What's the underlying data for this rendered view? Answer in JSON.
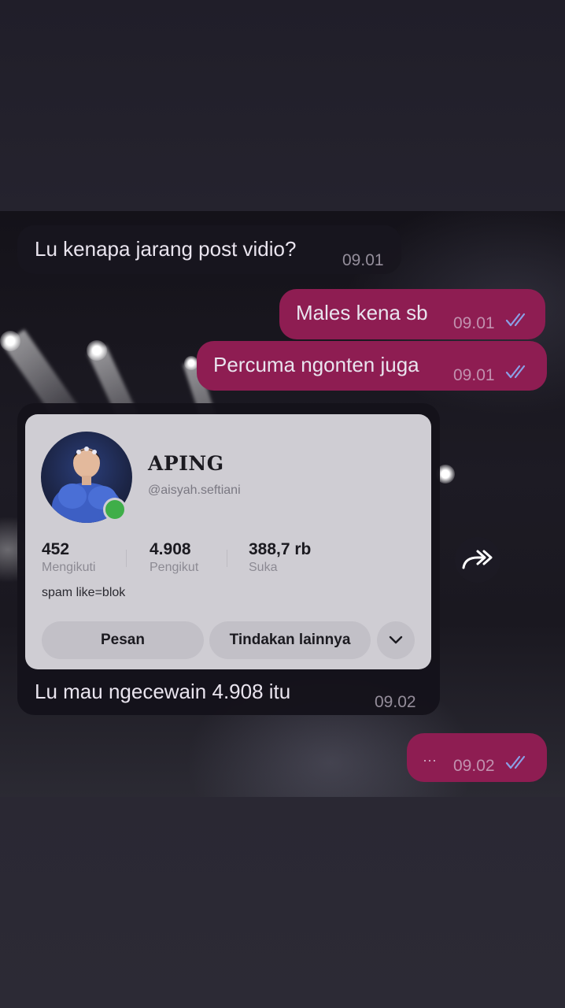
{
  "messages": {
    "m1": {
      "text": "Lu kenapa jarang post vidio?",
      "time": "09.01"
    },
    "m2": {
      "text": "Males kena sb",
      "time": "09.01"
    },
    "m3": {
      "text": "Percuma ngonten juga",
      "time": "09.01"
    },
    "m4": {
      "text": "Lu mau ngecewain 4.908 itu",
      "time": "09.02"
    },
    "m5": {
      "text": "···",
      "time": "09.02"
    }
  },
  "profile": {
    "name": "APING",
    "handle": "@aisyah.seftiani",
    "stats": [
      {
        "value": "452",
        "label": "Mengikuti"
      },
      {
        "value": "4.908",
        "label": "Pengikut"
      },
      {
        "value": "388,7 rb",
        "label": "Suka"
      }
    ],
    "bio": "spam like=blok",
    "buttons": {
      "message": "Pesan",
      "more": "Tindakan lainnya"
    }
  },
  "colors": {
    "outgoing_bubble": "#8e1d52",
    "incoming_bubble": "#18161e",
    "read_ticks": "#8aa0e6",
    "online": "#3fae49"
  }
}
